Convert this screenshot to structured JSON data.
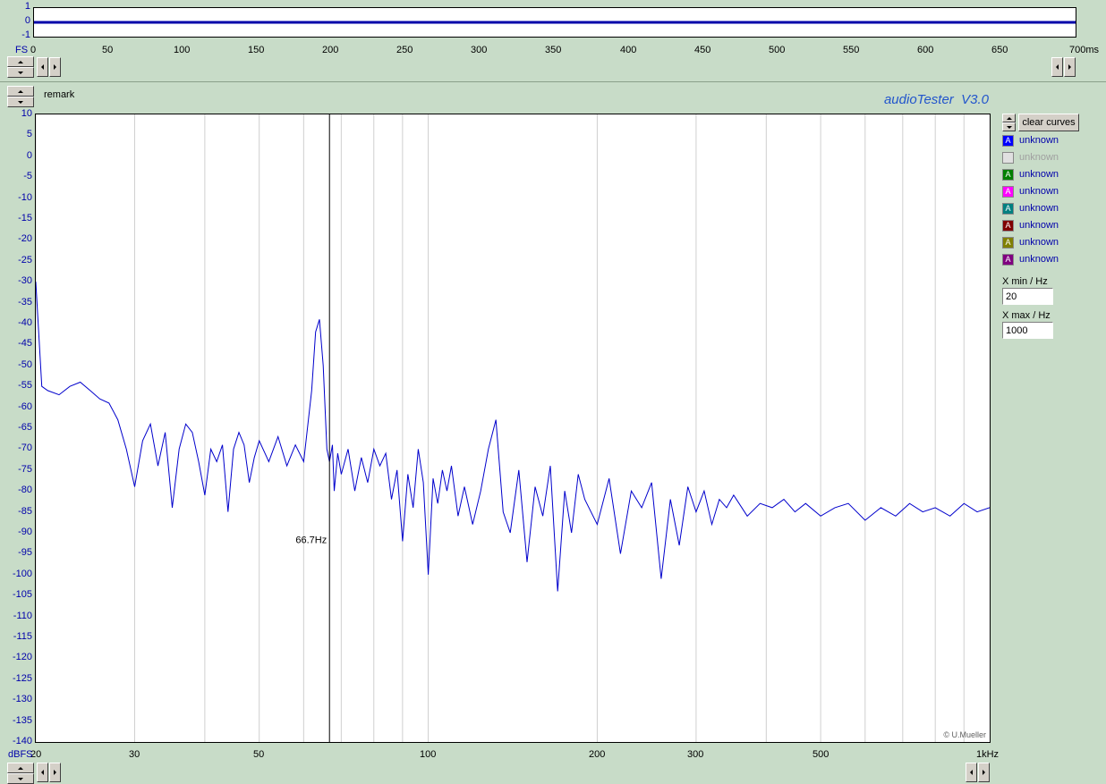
{
  "app": {
    "title": "audioTester  V3.0",
    "remark": "remark",
    "copyright": "© U.Mueller",
    "accent_color": "#2255cc"
  },
  "time_panel": {
    "y_ticks": [
      "1",
      "0",
      "-1"
    ],
    "x_ticks": [
      "0",
      "50",
      "100",
      "150",
      "200",
      "250",
      "300",
      "350",
      "400",
      "450",
      "500",
      "550",
      "600",
      "650",
      "700ms"
    ],
    "x_label_left": "FS"
  },
  "freq_panel": {
    "y_unit": "dBFS",
    "y_ticks": [
      "10",
      "5",
      "0",
      "-5",
      "-10",
      "-15",
      "-20",
      "-25",
      "-30",
      "-35",
      "-40",
      "-45",
      "-50",
      "-55",
      "-60",
      "-65",
      "-70",
      "-75",
      "-80",
      "-85",
      "-90",
      "-95",
      "-100",
      "-105",
      "-110",
      "-115",
      "-120",
      "-125",
      "-130",
      "-135",
      "-140"
    ],
    "x_ticks": [
      "20",
      "30",
      "50",
      "100",
      "200",
      "300",
      "500",
      "1kHz"
    ],
    "cursor_label": "66.7Hz"
  },
  "controls": {
    "clear_curves": "clear curves",
    "xmin_label": "X min / Hz",
    "xmin_value": "20",
    "xmax_label": "X max / Hz",
    "xmax_value": "1000"
  },
  "legend": [
    {
      "label": "unknown",
      "color": "#0000ff",
      "glyph": "A",
      "enabled": true
    },
    {
      "label": "unknown",
      "color": "#c8c8c8",
      "glyph": "",
      "enabled": false
    },
    {
      "label": "unknown",
      "color": "#008000",
      "glyph": "A",
      "enabled": true
    },
    {
      "label": "unknown",
      "color": "#ff00ff",
      "glyph": "A",
      "enabled": true
    },
    {
      "label": "unknown",
      "color": "#008080",
      "glyph": "A",
      "enabled": true
    },
    {
      "label": "unknown",
      "color": "#800000",
      "glyph": "A",
      "enabled": true
    },
    {
      "label": "unknown",
      "color": "#808000",
      "glyph": "A",
      "enabled": true
    },
    {
      "label": "unknown",
      "color": "#800080",
      "glyph": "A",
      "enabled": true
    }
  ],
  "chart_data": [
    {
      "type": "line",
      "xlabel": "ms",
      "ylabel": "FS",
      "xlim": [
        0,
        700
      ],
      "ylim": [
        -1,
        1
      ],
      "series": [
        {
          "color": "#0000aa",
          "x": [
            0,
            100,
            200,
            300,
            400,
            500,
            600,
            700
          ],
          "values": [
            0,
            0,
            0,
            0,
            0,
            0,
            0,
            0
          ]
        }
      ]
    },
    {
      "type": "line",
      "xscale": "log",
      "xlabel": "Hz",
      "ylabel": "dBFS",
      "xlim": [
        20,
        1000
      ],
      "ylim": [
        -140,
        10
      ],
      "cursor_x": 66.7,
      "grid": true,
      "series": [
        {
          "color": "#0000cc",
          "x": [
            20,
            20.5,
            21,
            22,
            23,
            24,
            25,
            26,
            27,
            28,
            29,
            30,
            31,
            32,
            33,
            34,
            35,
            36,
            37,
            38,
            39,
            40,
            41,
            42,
            43,
            44,
            45,
            46,
            47,
            48,
            49,
            50,
            52,
            54,
            56,
            58,
            60,
            62,
            63,
            64,
            65,
            66,
            66.7,
            67.5,
            68,
            69,
            70,
            72,
            74,
            76,
            78,
            80,
            82,
            84,
            86,
            88,
            90,
            92,
            94,
            96,
            98,
            100,
            102,
            104,
            106,
            108,
            110,
            113,
            116,
            120,
            124,
            128,
            132,
            136,
            140,
            145,
            150,
            155,
            160,
            165,
            170,
            175,
            180,
            185,
            190,
            200,
            210,
            220,
            230,
            240,
            250,
            260,
            270,
            280,
            290,
            300,
            310,
            320,
            330,
            340,
            350,
            370,
            390,
            410,
            430,
            450,
            470,
            500,
            530,
            560,
            600,
            640,
            680,
            720,
            760,
            800,
            850,
            900,
            950,
            1000
          ],
          "values": [
            -30,
            -55,
            -56,
            -57,
            -55,
            -54,
            -56,
            -58,
            -59,
            -63,
            -70,
            -79,
            -68,
            -64,
            -74,
            -66,
            -84,
            -70,
            -64,
            -66,
            -73,
            -81,
            -70,
            -73,
            -69,
            -85,
            -70,
            -66,
            -69,
            -78,
            -72,
            -68,
            -73,
            -67,
            -74,
            -69,
            -73,
            -56,
            -42,
            -39,
            -50,
            -70,
            -73,
            -69,
            -80,
            -71,
            -76,
            -70,
            -80,
            -72,
            -78,
            -70,
            -74,
            -71,
            -82,
            -75,
            -92,
            -76,
            -84,
            -70,
            -78,
            -100,
            -77,
            -83,
            -75,
            -80,
            -74,
            -86,
            -79,
            -88,
            -80,
            -70,
            -63,
            -85,
            -90,
            -75,
            -97,
            -79,
            -86,
            -74,
            -104,
            -80,
            -90,
            -76,
            -82,
            -88,
            -77,
            -95,
            -80,
            -84,
            -78,
            -101,
            -82,
            -93,
            -79,
            -85,
            -80,
            -88,
            -82,
            -84,
            -81,
            -86,
            -83,
            -84,
            -82,
            -85,
            -83,
            -86,
            -84,
            -83,
            -87,
            -84,
            -86,
            -83,
            -85,
            -84,
            -86,
            -83,
            -85,
            -84
          ]
        }
      ]
    }
  ]
}
